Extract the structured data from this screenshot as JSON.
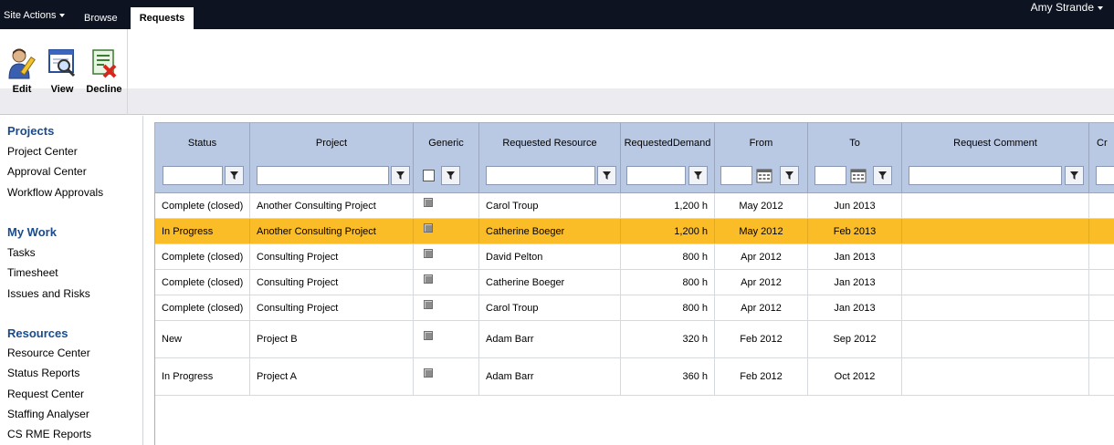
{
  "topbar": {
    "site_actions": "Site Actions",
    "browse": "Browse",
    "requests_tab": "Requests",
    "user": "Amy Strande"
  },
  "ribbon": {
    "edit": "Edit",
    "view": "View",
    "decline": "Decline"
  },
  "nav": {
    "projects": "Projects",
    "project_center": "Project Center",
    "approval_center": "Approval Center",
    "workflow_approvals": "Workflow Approvals",
    "my_work": "My Work",
    "tasks": "Tasks",
    "timesheet": "Timesheet",
    "issues_risks": "Issues and Risks",
    "resources": "Resources",
    "resource_center": "Resource Center",
    "status_reports": "Status Reports",
    "request_center": "Request Center",
    "staffing_analyser": "Staffing Analyser",
    "cs_rme_reports": "CS RME Reports"
  },
  "columns": {
    "status": "Status",
    "project": "Project",
    "generic": "Generic",
    "requested_resource": "Requested Resource",
    "requested_demand_1": "Requested",
    "requested_demand_2": "Demand",
    "from": "From",
    "to": "To",
    "request_comment": "Request Comment",
    "next": "Cr"
  },
  "colors": {
    "selected_row": "#fbbd27",
    "header": "#b9c8e3",
    "nav_heading": "#1a4b8d"
  },
  "rows": [
    {
      "status": "Complete (closed)",
      "project": "Another Consulting Project",
      "resource": "Carol Troup",
      "demand": "1,200 h",
      "from": "May 2012",
      "to": "Jun 2013",
      "selected": false
    },
    {
      "status": "In Progress",
      "project": "Another Consulting Project",
      "resource": "Catherine Boeger",
      "demand": "1,200 h",
      "from": "May 2012",
      "to": "Feb 2013",
      "selected": true
    },
    {
      "status": "Complete (closed)",
      "project": "Consulting Project",
      "resource": "David Pelton",
      "demand": "800 h",
      "from": "Apr 2012",
      "to": "Jan 2013",
      "selected": false
    },
    {
      "status": "Complete (closed)",
      "project": "Consulting Project",
      "resource": "Catherine Boeger",
      "demand": "800 h",
      "from": "Apr 2012",
      "to": "Jan 2013",
      "selected": false
    },
    {
      "status": "Complete (closed)",
      "project": "Consulting Project",
      "resource": "Carol Troup",
      "demand": "800 h",
      "from": "Apr 2012",
      "to": "Jan 2013",
      "selected": false
    },
    {
      "status": "New",
      "project": "Project B",
      "resource": "Adam Barr",
      "demand": "320 h",
      "from": "Feb 2012",
      "to": "Sep 2012",
      "selected": false
    },
    {
      "status": "In Progress",
      "project": "Project A",
      "resource": "Adam Barr",
      "demand": "360 h",
      "from": "Feb 2012",
      "to": "Oct 2012",
      "selected": false
    }
  ]
}
